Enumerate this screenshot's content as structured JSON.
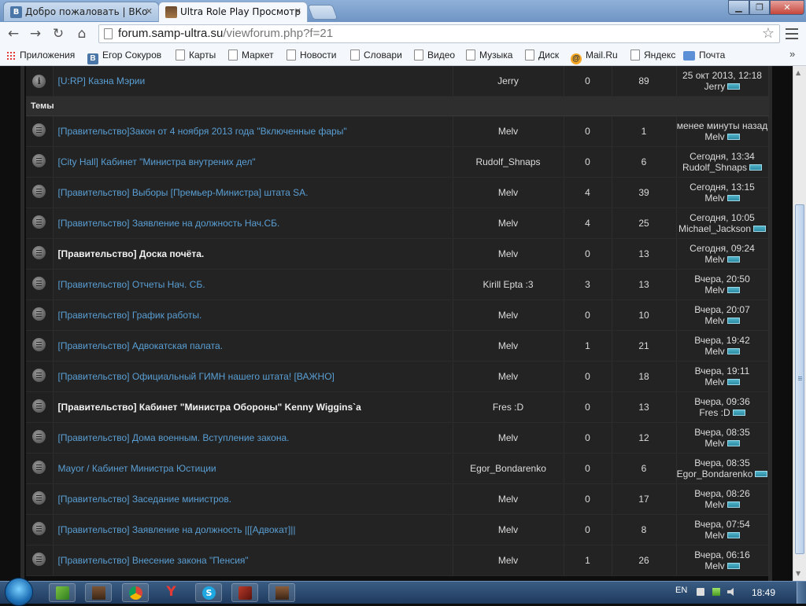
{
  "browser": {
    "tabs": [
      {
        "title": "Добро пожаловать | ВКо",
        "icon": "vk-favicon"
      },
      {
        "title": "Ultra Role Play Просмотр",
        "icon": "site-favicon"
      }
    ],
    "address": {
      "host": "forum.samp-ultra.su",
      "path": "/viewforum.php?f=21"
    },
    "bookmarks": [
      {
        "label": "Приложения",
        "icon": "apps-icon"
      },
      {
        "label": "Егор Сокуров",
        "icon": "vk-icon"
      },
      {
        "label": "Карты",
        "icon": "page-icon"
      },
      {
        "label": "Маркет",
        "icon": "page-icon"
      },
      {
        "label": "Новости",
        "icon": "page-icon"
      },
      {
        "label": "Словари",
        "icon": "page-icon"
      },
      {
        "label": "Видео",
        "icon": "page-icon"
      },
      {
        "label": "Музыка",
        "icon": "page-icon"
      },
      {
        "label": "Диск",
        "icon": "page-icon"
      },
      {
        "label": "Mail.Ru",
        "icon": "mailru-icon"
      },
      {
        "label": "Яндекс",
        "icon": "page-icon"
      },
      {
        "label": "Почта",
        "icon": "mail-icon"
      }
    ],
    "bookmarks_more": "»"
  },
  "forum": {
    "announcement": {
      "title": "[U:RP] Казна Мэрии",
      "author": "Jerry",
      "replies": "0",
      "views": "89",
      "last_time": "25 окт 2013, 12:18",
      "last_user": "Jerry"
    },
    "section_label": "Темы",
    "topics": [
      {
        "title": "[Правительство]Закон от 4 ноября 2013 года \"Включенные фары\"",
        "author": "Melv",
        "replies": "0",
        "views": "1",
        "last_time": "менее минуты назад",
        "last_user": "Melv",
        "style": "link"
      },
      {
        "title": "[City Hall] Кабинет \"Министра внутрених дел\"",
        "author": "Rudolf_Shnaps",
        "replies": "0",
        "views": "6",
        "last_time": "Сегодня, 13:34",
        "last_user": "Rudolf_Shnaps",
        "style": "link"
      },
      {
        "title": "[Правительство] Выборы [Премьер-Министра] штата SA.",
        "author": "Melv",
        "replies": "4",
        "views": "39",
        "last_time": "Сегодня, 13:15",
        "last_user": "Melv",
        "style": "link"
      },
      {
        "title": "[Правительство] Заявление на должность Нач.СБ.",
        "author": "Melv",
        "replies": "4",
        "views": "25",
        "last_time": "Сегодня, 10:05",
        "last_user": "Michael_Jackson",
        "style": "link"
      },
      {
        "title": "[Правительство] Доска почёта.",
        "author": "Melv",
        "replies": "0",
        "views": "13",
        "last_time": "Сегодня, 09:24",
        "last_user": "Melv",
        "style": "white"
      },
      {
        "title": "[Правительство] Отчеты Нач. СБ.",
        "author": "Kirill Epta :3",
        "replies": "3",
        "views": "13",
        "last_time": "Вчера, 20:50",
        "last_user": "Melv",
        "style": "link"
      },
      {
        "title": "[Правительство] График работы.",
        "author": "Melv",
        "replies": "0",
        "views": "10",
        "last_time": "Вчера, 20:07",
        "last_user": "Melv",
        "style": "link"
      },
      {
        "title": "[Правительство] Адвокатская палата.",
        "author": "Melv",
        "replies": "1",
        "views": "21",
        "last_time": "Вчера, 19:42",
        "last_user": "Melv",
        "style": "link"
      },
      {
        "title": "[Правительство] Официальный ГИМН нашего штата! [ВАЖНО]",
        "author": "Melv",
        "replies": "0",
        "views": "18",
        "last_time": "Вчера, 19:11",
        "last_user": "Melv",
        "style": "link"
      },
      {
        "title": "[Правительство] Кабинет \"Министра Обороны\" Kenny Wiggins`a",
        "author": "Fres :D",
        "replies": "0",
        "views": "13",
        "last_time": "Вчера, 09:36",
        "last_user": "Fres :D",
        "style": "white"
      },
      {
        "title": "[Правительство] Дома военным. Вступление закона.",
        "author": "Melv",
        "replies": "0",
        "views": "12",
        "last_time": "Вчера, 08:35",
        "last_user": "Melv",
        "style": "link"
      },
      {
        "title": "Mayor / Кабинет Министра Юстиции",
        "author": "Egor_Bondarenko",
        "replies": "0",
        "views": "6",
        "last_time": "Вчера, 08:35",
        "last_user": "Egor_Bondarenko",
        "style": "link"
      },
      {
        "title": "[Правительство] Заседание министров.",
        "author": "Melv",
        "replies": "0",
        "views": "17",
        "last_time": "Вчера, 08:26",
        "last_user": "Melv",
        "style": "link"
      },
      {
        "title": "[Правительство] Заявление на должность |[[Адвокат]||",
        "author": "Melv",
        "replies": "0",
        "views": "8",
        "last_time": "Вчера, 07:54",
        "last_user": "Melv",
        "style": "link"
      },
      {
        "title": "[Правительство] Внесение закона \"Пенсия\"",
        "author": "Melv",
        "replies": "1",
        "views": "26",
        "last_time": "Вчера, 06:16",
        "last_user": "Melv",
        "style": "link"
      }
    ]
  },
  "taskbar": {
    "language": "EN",
    "clock": "18:49"
  }
}
